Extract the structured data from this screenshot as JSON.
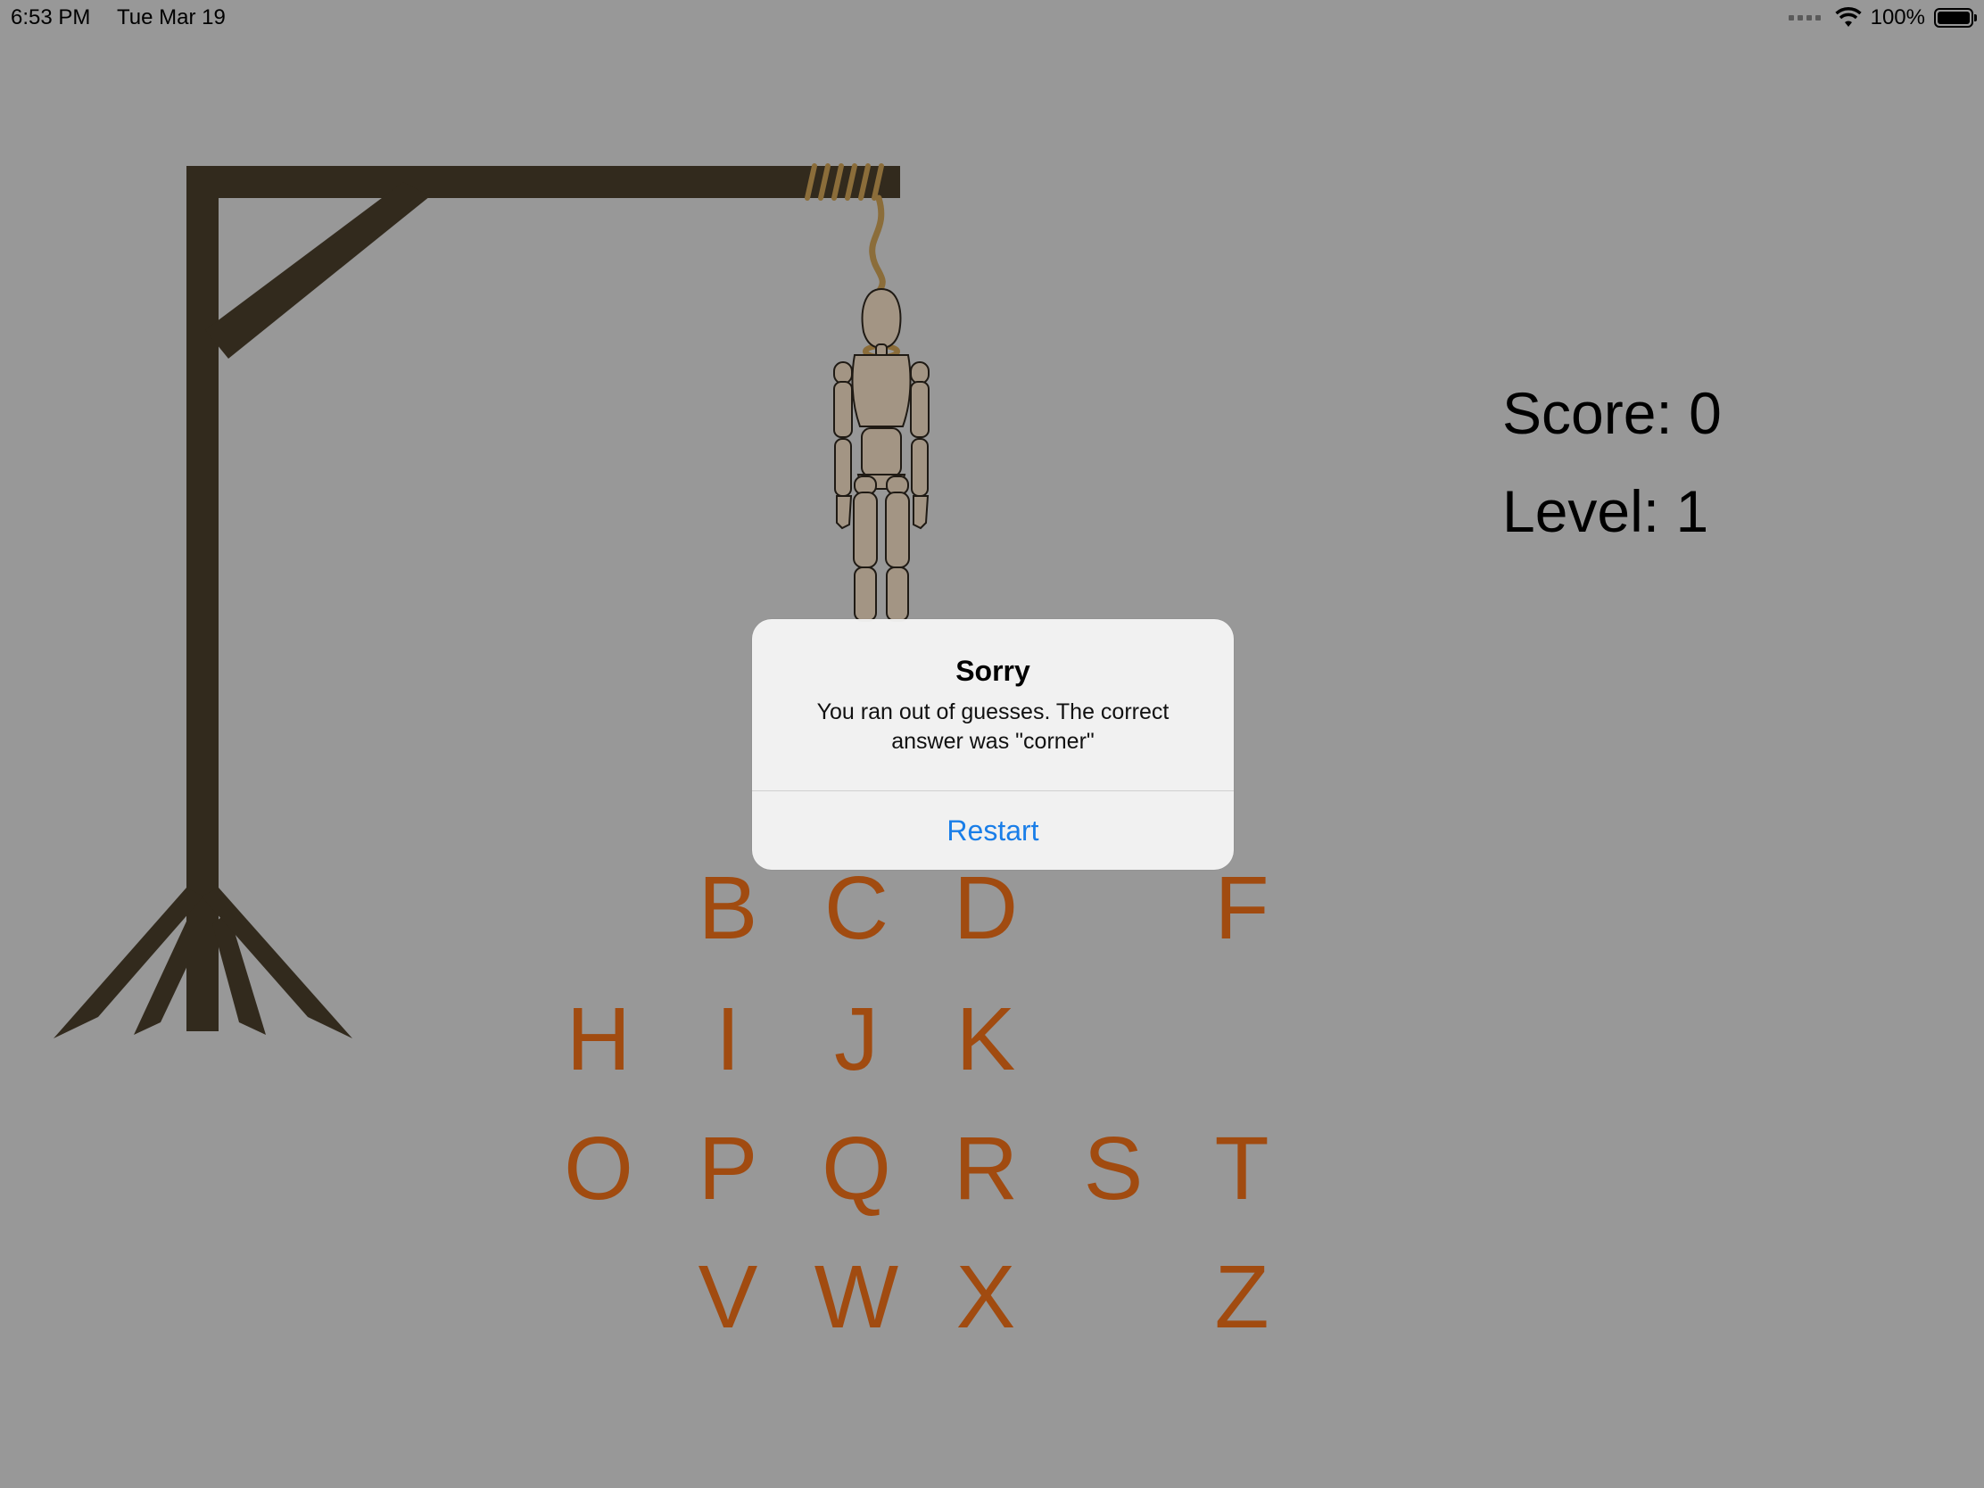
{
  "status_bar": {
    "time": "6:53 PM",
    "date": "Tue Mar 19",
    "battery_label": "100%"
  },
  "score": {
    "score_label": "Score: 0",
    "level_label": "Level: 1"
  },
  "letters": {
    "row1": {
      "B": "B",
      "C": "C",
      "D": "D",
      "F": "F"
    },
    "row2": {
      "H": "H",
      "I": "I",
      "J": "J",
      "K": "K"
    },
    "row3": {
      "O": "O",
      "P": "P",
      "Q": "Q",
      "R": "R",
      "S": "S",
      "T": "T"
    },
    "row4": {
      "V": "V",
      "W": "W",
      "X": "X",
      "Z": "Z"
    }
  },
  "alert": {
    "title": "Sorry",
    "message": "You ran out of guesses. The correct answer was \"corner\"",
    "button_label": "Restart"
  },
  "colors": {
    "background": "#989898",
    "gallows": "#322a1d",
    "rope": "#8b6d3a",
    "figure": "#a39584",
    "letter": "#a14b10",
    "button": "#1a7ee8"
  }
}
